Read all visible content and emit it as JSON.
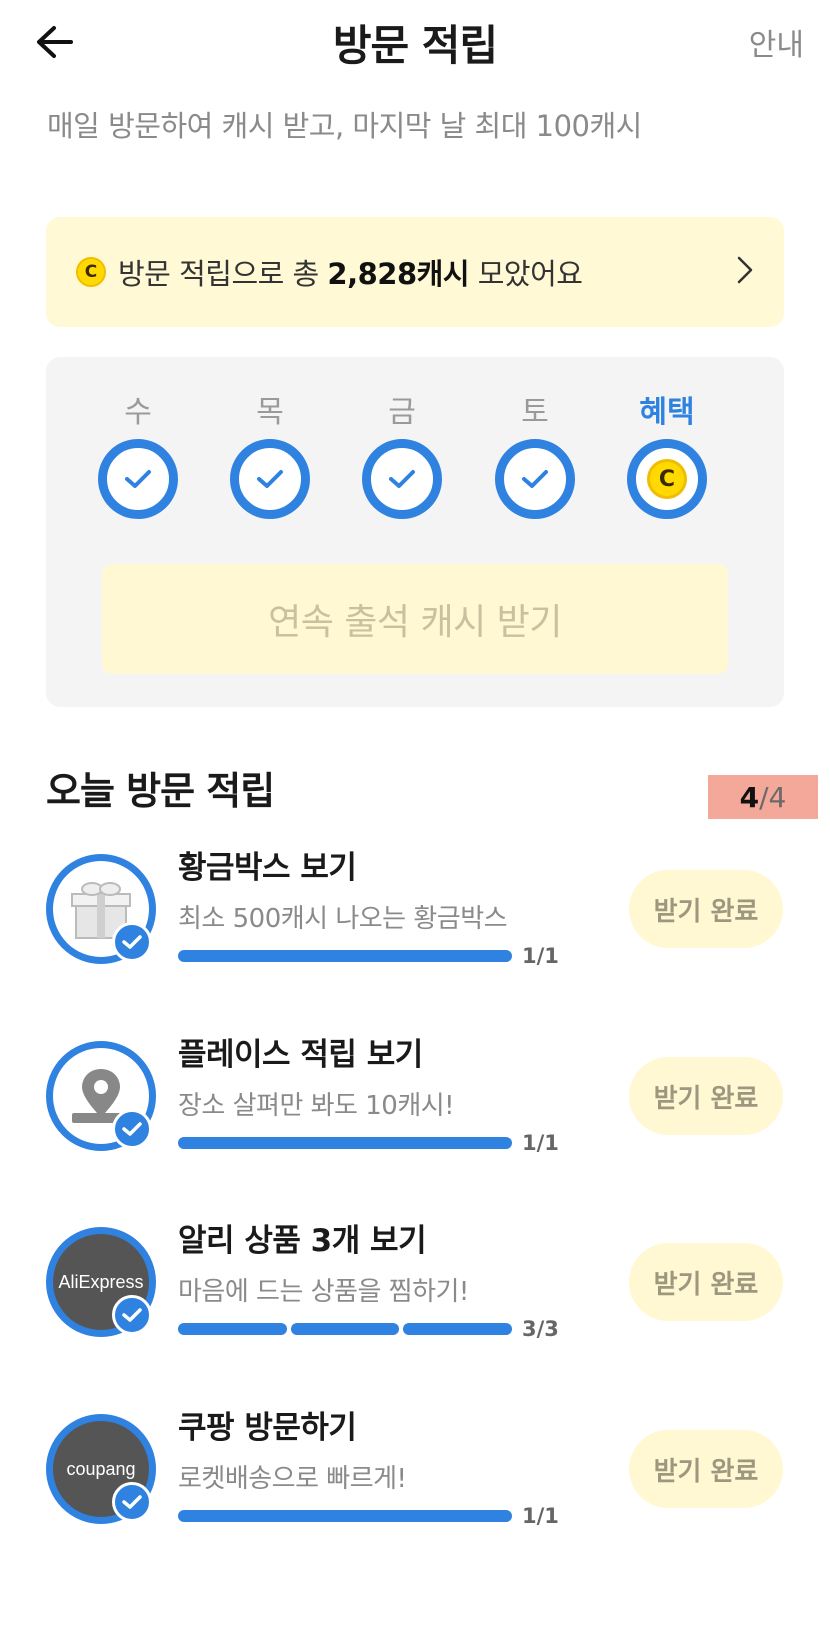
{
  "header": {
    "title": "방문 적립",
    "guide_label": "안내"
  },
  "subtitle": "매일 방문하여 캐시 받고, 마지막 날 최대 100캐시",
  "summary": {
    "prefix": "방문 적립으로 총 ",
    "amount": "2,828캐시",
    "suffix": " 모았어요",
    "coin_label": "C"
  },
  "streak": {
    "days": [
      {
        "label": "수",
        "state": "checked"
      },
      {
        "label": "목",
        "state": "checked"
      },
      {
        "label": "금",
        "state": "checked"
      },
      {
        "label": "토",
        "state": "checked"
      },
      {
        "label": "혜택",
        "state": "reward"
      }
    ],
    "claim_label": "연속 출석 캐시 받기"
  },
  "today": {
    "title": "오늘 방문 적립",
    "done": "4",
    "total": "/4"
  },
  "missions": [
    {
      "title": "황금박스 보기",
      "desc": "최소 500캐시 나오는 황금박스",
      "count": "1/1",
      "button": "받기 완료",
      "icon": "gift-box-icon",
      "done": 1,
      "goal": 1
    },
    {
      "title": "플레이스 적립 보기",
      "desc": "장소 살펴만 봐도 10캐시!",
      "count": "1/1",
      "button": "받기 완료",
      "icon": "map-pin-icon",
      "done": 1,
      "goal": 1
    },
    {
      "title": "알리 상품 3개 보기",
      "desc": "마음에 드는 상품을 찜하기!",
      "count": "3/3",
      "button": "받기 완료",
      "icon": "aliexpress-logo",
      "brand": "AliExpress",
      "done": 3,
      "goal": 3
    },
    {
      "title": "쿠팡 방문하기",
      "desc": "로켓배송으로 빠르게!",
      "count": "1/1",
      "button": "받기 완료",
      "icon": "coupang-logo",
      "brand": "coupang",
      "done": 1,
      "goal": 1
    }
  ],
  "colors": {
    "accent": "#2f82e0",
    "highlight_bg": "#fff9d6",
    "coin": "#ffd900"
  }
}
